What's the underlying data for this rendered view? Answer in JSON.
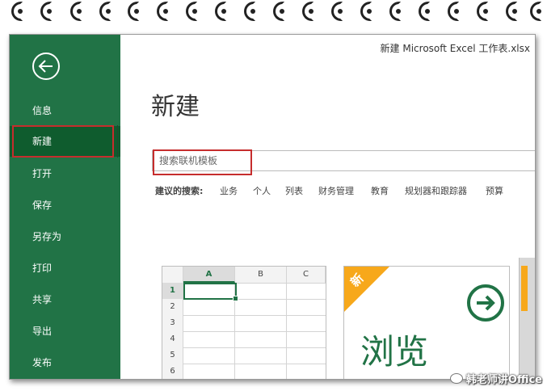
{
  "window": {
    "doc_title": "新建 Microsoft Excel 工作表.xlsx"
  },
  "sidebar": {
    "items": [
      {
        "label": "信息"
      },
      {
        "label": "新建"
      },
      {
        "label": "打开"
      },
      {
        "label": "保存"
      },
      {
        "label": "另存为"
      },
      {
        "label": "打印"
      },
      {
        "label": "共享"
      },
      {
        "label": "导出"
      },
      {
        "label": "发布"
      }
    ],
    "active_index": 1
  },
  "main": {
    "title": "新建",
    "search": {
      "placeholder": "搜索联机模板",
      "value": ""
    },
    "suggestions": {
      "label": "建议的搜索:",
      "items": [
        "业务",
        "个人",
        "列表",
        "财务管理",
        "教育",
        "规划器和跟踪器",
        "预算"
      ]
    },
    "blank_workbook": {
      "columns": [
        "A",
        "B",
        "C"
      ],
      "rows": [
        "1",
        "2",
        "3",
        "4",
        "5",
        "6"
      ]
    },
    "tour_card": {
      "badge": "新",
      "text": "浏览"
    }
  },
  "watermark": {
    "text": "韩老师讲Office"
  },
  "colors": {
    "brand": "#217346",
    "highlight": "#c62d2d",
    "accent": "#f7a81b"
  }
}
